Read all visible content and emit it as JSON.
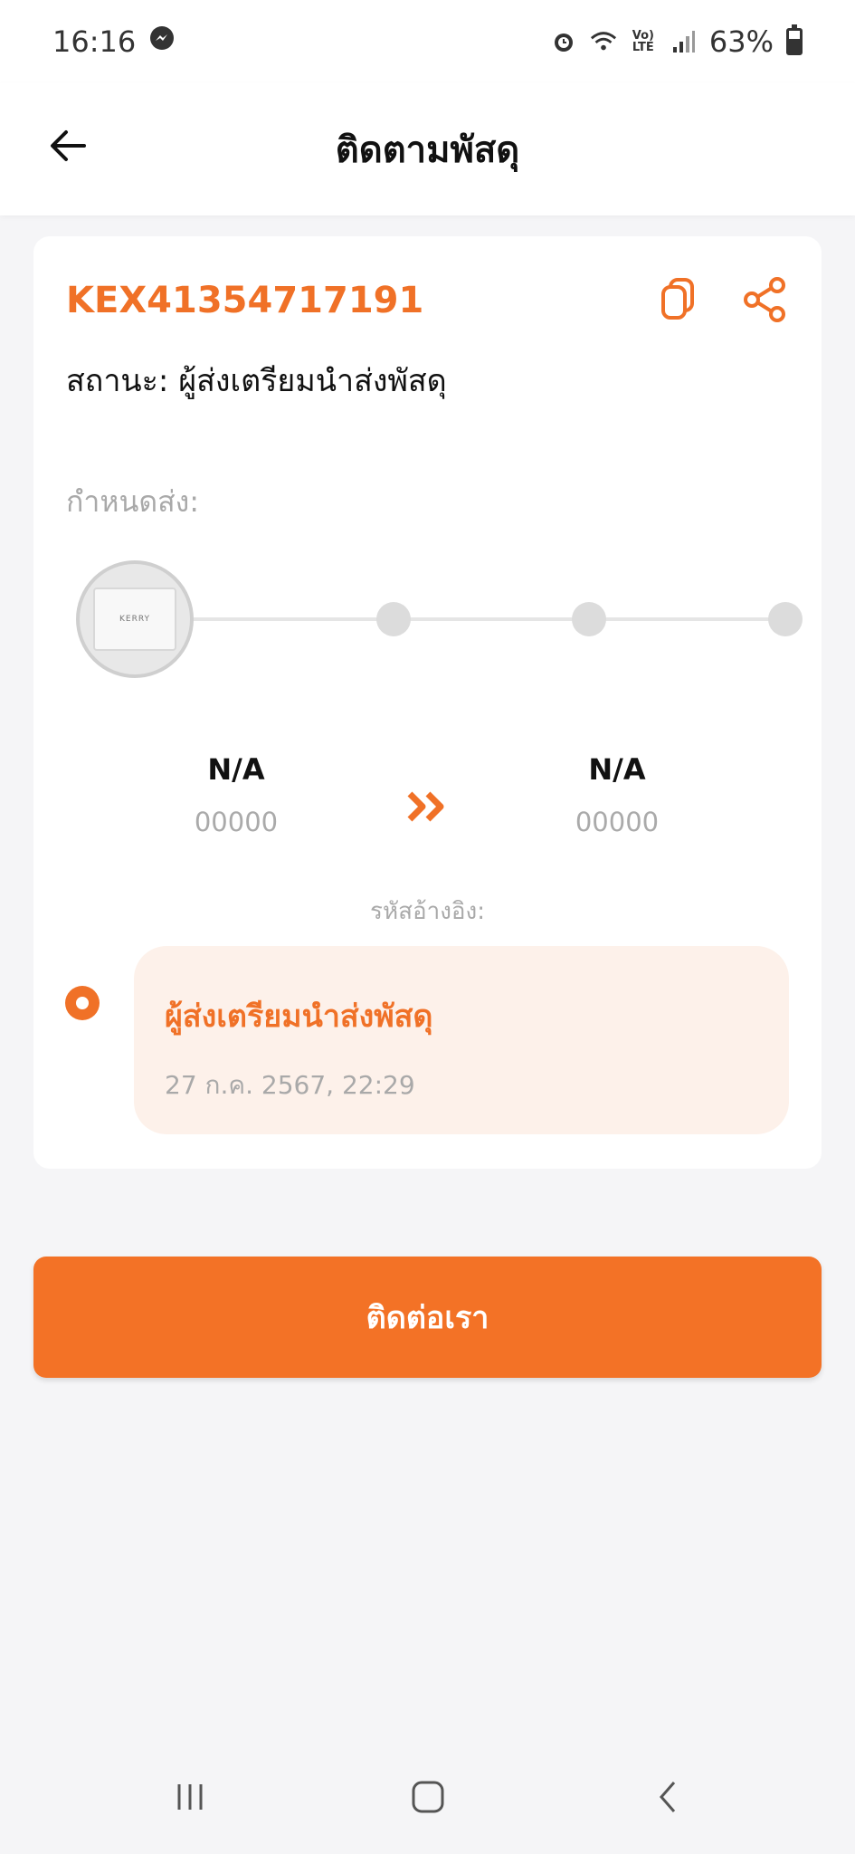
{
  "status_bar": {
    "time": "16:16",
    "battery": "63%",
    "battery_level": 0.63,
    "icons": [
      "messenger-icon",
      "alarm-icon",
      "wifi-6-icon",
      "volte-icon",
      "signal-icon",
      "battery-icon"
    ]
  },
  "header": {
    "title": "ติดตามพัสดุ",
    "back_icon": "back-arrow-icon"
  },
  "parcel": {
    "tracking_number": "KEX41354717191",
    "status_text": "สถานะ: ผู้ส่งเตรียมนำส่งพัสดุ",
    "due_label": "กำหนดส่ง:",
    "progress": {
      "total_steps": 4,
      "current_step": 1,
      "current_step_image": "kerry-box-icon",
      "brand_label": "KERRY"
    },
    "origin": {
      "city": "N/A",
      "zip": "00000"
    },
    "destination": {
      "city": "N/A",
      "zip": "00000"
    },
    "reference_label": "รหัสอ้างอิง:",
    "events": [
      {
        "title": "ผู้ส่งเตรียมนำส่งพัสดุ",
        "datetime": "27 ก.ค. 2567, 22:29"
      }
    ]
  },
  "contact_button": {
    "label": "ติดต่อเรา"
  },
  "colors": {
    "accent": "#F07127",
    "event_bg": "#FDF1EA",
    "muted": "#A9A9A9"
  },
  "nav_bar": {
    "icons": [
      "recent-apps-icon",
      "home-icon",
      "back-icon"
    ]
  }
}
